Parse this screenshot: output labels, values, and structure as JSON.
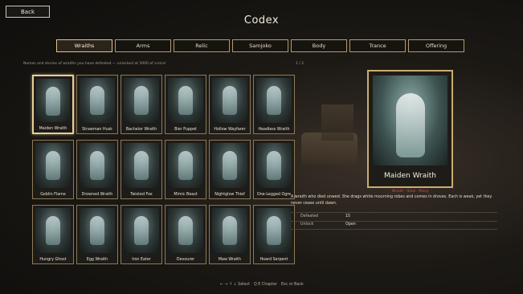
{
  "header": {
    "back_label": "Back",
    "title": "Codex"
  },
  "tabs": [
    {
      "label": "Wraiths",
      "active": true
    },
    {
      "label": "Arms",
      "active": false
    },
    {
      "label": "Relic",
      "active": false
    },
    {
      "label": "Samjoko",
      "active": false
    },
    {
      "label": "Body",
      "active": false
    },
    {
      "label": "Trance",
      "active": false
    },
    {
      "label": "Offering",
      "active": false
    }
  ],
  "subtitle": "Names and stories of wraiths you have defeated — unlocked at 5000 of a kind",
  "pager": "1 / 2",
  "cards": [
    {
      "name": "Maiden Wraith",
      "selected": true
    },
    {
      "name": "Strawman Husk"
    },
    {
      "name": "Bachelor Wraith"
    },
    {
      "name": "Bier Puppet"
    },
    {
      "name": "Hollow Wayfarer"
    },
    {
      "name": "Headless Wraith"
    },
    {
      "name": "Goblin Flame"
    },
    {
      "name": "Drowned Wraith"
    },
    {
      "name": "Twisted Fox"
    },
    {
      "name": "Mimic Beast"
    },
    {
      "name": "Nightglow Thief"
    },
    {
      "name": "One-Legged Ogre"
    },
    {
      "name": "Hungry Ghost"
    },
    {
      "name": "Egg Wraith"
    },
    {
      "name": "Iron Eater"
    },
    {
      "name": "Devourer"
    },
    {
      "name": "Maw Wraith"
    },
    {
      "name": "Hoard Serpent"
    }
  ],
  "detail": {
    "name": "Maiden Wraith",
    "tags": "Wraith · Slow · Many",
    "description": "A wraith who died unwed. She drags white mourning robes and comes in droves. Each is weak, yet they never cease until dawn.",
    "stats": [
      {
        "label": "Defeated",
        "value": "15"
      },
      {
        "label": "Unlock",
        "value": "Open"
      }
    ]
  },
  "footer": {
    "select_hint": "← → ↑ ↓ Select",
    "chapter_hint": "Q E Chapter",
    "back_hint": "Esc or Back"
  },
  "colors": {
    "accent": "#e0c48a",
    "tag_red": "#d2483f",
    "frame": "#8c7a58"
  }
}
